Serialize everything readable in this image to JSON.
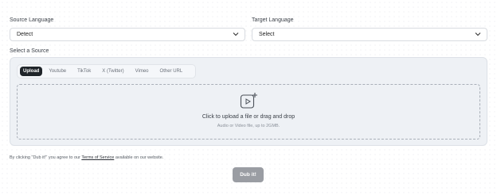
{
  "source_language": {
    "label": "Source Language",
    "value": "Detect"
  },
  "target_language": {
    "label": "Target Language",
    "value": "Select"
  },
  "source": {
    "label": "Select a Source",
    "tabs": [
      {
        "label": "Upload",
        "active": true
      },
      {
        "label": "Youtube",
        "active": false
      },
      {
        "label": "TikTok",
        "active": false
      },
      {
        "label": "X (Twitter)",
        "active": false
      },
      {
        "label": "Vimeo",
        "active": false
      },
      {
        "label": "Other URL",
        "active": false
      }
    ],
    "dropzone": {
      "icon": "video-add-icon",
      "title": "Click to upload a file or drag and drop",
      "subtitle": "Audio or Video file, up to 2GMB."
    }
  },
  "terms": {
    "prefix": "By clicking \"Dub it!\" you agree to our ",
    "link": "Terms of Service",
    "suffix": " available on our website."
  },
  "submit": {
    "label": "Dub it!"
  },
  "colors": {
    "primary_tab": "#1f2429",
    "button_disabled": "#9a9da3",
    "panel": "#eef1f5"
  }
}
